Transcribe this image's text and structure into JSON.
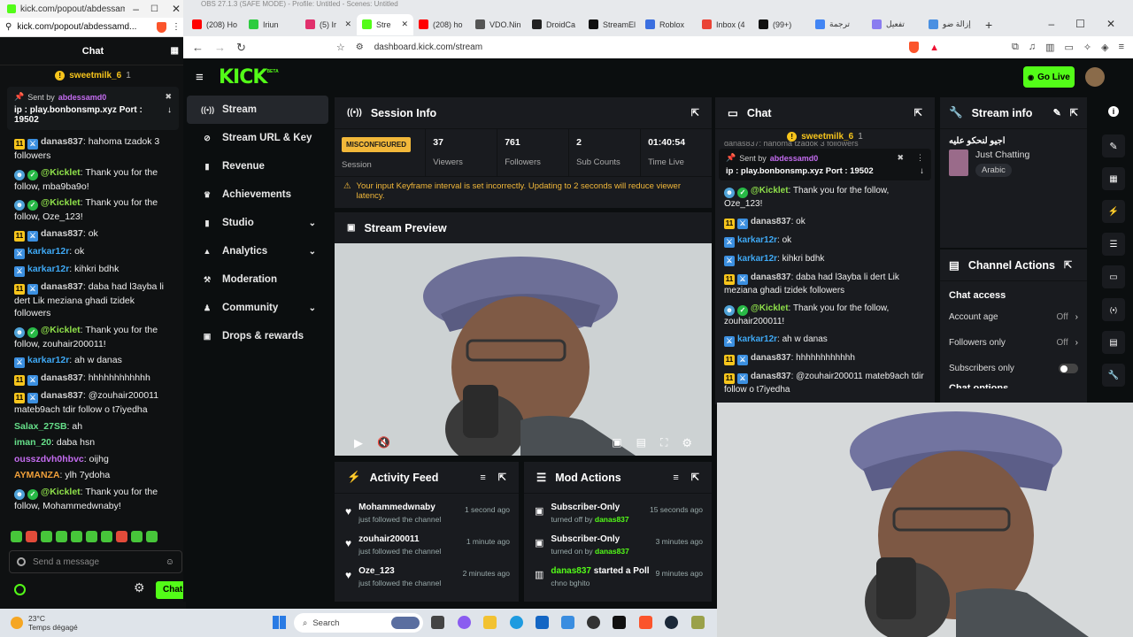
{
  "popout": {
    "window_title": "kick.com/popout/abdessam...",
    "url": "kick.com/popout/abdessamd...",
    "chat_title": "Chat",
    "gift_user": "sweetmilk_6",
    "gift_count": "1",
    "pinned_sent_by": "Sent by",
    "pinned_user": "abdessamd0",
    "pinned_text": "ip : play.bonbonsmp.xyz Port : 19502",
    "messages": [
      {
        "user": "danas837",
        "color": "#d2d2d2",
        "badges": [
          "y",
          "b"
        ],
        "text": "hahoma tzadok 3 followers"
      },
      {
        "user": "@Kicklet",
        "color": "#8fe04a",
        "badges": [
          "r",
          "g"
        ],
        "text": "Thank you for the follow, mba9ba9o!"
      },
      {
        "user": "@Kicklet",
        "color": "#8fe04a",
        "badges": [
          "r",
          "g"
        ],
        "text": "Thank you for the follow, Oze_123!"
      },
      {
        "user": "danas837",
        "color": "#d2d2d2",
        "badges": [
          "y",
          "b"
        ],
        "text": "ok"
      },
      {
        "user": "karkar12r",
        "color": "#3fa9f5",
        "badges": [
          "b"
        ],
        "text": "ok"
      },
      {
        "user": "karkar12r",
        "color": "#3fa9f5",
        "badges": [
          "b"
        ],
        "text": "kihkri bdhk"
      },
      {
        "user": "danas837",
        "color": "#d2d2d2",
        "badges": [
          "y",
          "b"
        ],
        "text": "daba had l3ayba li dert Lik meziana ghadi tzidek followers"
      },
      {
        "user": "@Kicklet",
        "color": "#8fe04a",
        "badges": [
          "r",
          "g"
        ],
        "text": "Thank you for the follow, zouhair200011!"
      },
      {
        "user": "karkar12r",
        "color": "#3fa9f5",
        "badges": [
          "b"
        ],
        "text": "ah w danas"
      },
      {
        "user": "danas837",
        "color": "#d2d2d2",
        "badges": [
          "y",
          "b"
        ],
        "text": "hhhhhhhhhhhh"
      },
      {
        "user": "danas837",
        "color": "#d2d2d2",
        "badges": [
          "y",
          "b"
        ],
        "text": "@zouhair200011 mateb9ach tdir follow o t7iyedha"
      },
      {
        "user": "Salax_27SB",
        "color": "#66e08a",
        "badges": [],
        "text": "ah"
      },
      {
        "user": "iman_20",
        "color": "#66e08a",
        "badges": [],
        "text": "daba hsn"
      },
      {
        "user": "ousszdvh0hbvc",
        "color": "#c46cf0",
        "badges": [],
        "text": "oijhg"
      },
      {
        "user": "AYMANZA",
        "color": "#f0a03a",
        "badges": [],
        "text": "ylh 7ydoha"
      },
      {
        "user": "@Kicklet",
        "color": "#8fe04a",
        "badges": [
          "r",
          "g"
        ],
        "text": "Thank you for the follow, Mohammedwnaby!"
      }
    ],
    "send_placeholder": "Send a message",
    "chat_button": "Chat"
  },
  "browser": {
    "os_title": "OBS 27.1.3 (SAFE MODE) - Profile: Untitled - Scenes: Untitled",
    "tabs": [
      {
        "label": "(208) Ho",
        "color": "#ff0000"
      },
      {
        "label": "Iriun",
        "color": "#2ecc40"
      },
      {
        "label": "(5) Ir",
        "color": "#e1306c"
      },
      {
        "label": "Stre",
        "color": "#53fc18"
      },
      {
        "label": "(208) ho",
        "color": "#ff0000"
      },
      {
        "label": "VDO.Nin",
        "color": "#555555"
      },
      {
        "label": "DroidCa",
        "color": "#222222"
      },
      {
        "label": "StreamEl",
        "color": "#111111"
      },
      {
        "label": "Roblox",
        "color": "#3b6fe0"
      },
      {
        "label": "Inbox (4",
        "color": "#ea4335"
      },
      {
        "label": "(99+)",
        "color": "#111111"
      },
      {
        "label": "ترجمة",
        "color": "#4285f4"
      },
      {
        "label": "تفعيل",
        "color": "#8a7cf0"
      },
      {
        "label": "إزالة ضو",
        "color": "#4a90e2"
      }
    ],
    "url": "dashboard.kick.com/stream"
  },
  "kick": {
    "logo": "KICK",
    "logo_beta": "BETA",
    "go_live": "Go Live",
    "nav": [
      {
        "label": "Stream",
        "icon": "broadcast-icon",
        "active": true
      },
      {
        "label": "Stream URL & Key",
        "icon": "link-icon"
      },
      {
        "label": "Revenue",
        "icon": "revenue-icon"
      },
      {
        "label": "Achievements",
        "icon": "trophy-icon"
      },
      {
        "label": "Studio",
        "icon": "studio-icon",
        "chevron": true
      },
      {
        "label": "Analytics",
        "icon": "analytics-icon",
        "chevron": true
      },
      {
        "label": "Moderation",
        "icon": "hammer-icon"
      },
      {
        "label": "Community",
        "icon": "community-icon",
        "chevron": true
      },
      {
        "label": "Drops & rewards",
        "icon": "gift-icon"
      }
    ],
    "session": {
      "title": "Session Info",
      "status_badge": "MISCONFIGURED",
      "status_label": "Session",
      "stats": [
        {
          "value": "37",
          "label": "Viewers"
        },
        {
          "value": "761",
          "label": "Followers"
        },
        {
          "value": "2",
          "label": "Sub Counts"
        },
        {
          "value": "01:40:54",
          "label": "Time Live"
        }
      ],
      "warning": "Your input Keyframe interval is set incorrectly. Updating to 2 seconds will reduce viewer latency."
    },
    "preview": {
      "title": "Stream Preview"
    },
    "activity": {
      "title": "Activity Feed",
      "items": [
        {
          "user": "Mohammedwnaby",
          "action": "just followed the channel",
          "ago": "1 second ago"
        },
        {
          "user": "zouhair200011",
          "action": "just followed the channel",
          "ago": "1 minute ago"
        },
        {
          "user": "Oze_123",
          "action": "just followed the channel",
          "ago": "2 minutes ago"
        }
      ]
    },
    "mod": {
      "title": "Mod Actions",
      "items": [
        {
          "title": "Subscriber-Only",
          "detail_prefix": "turned off by",
          "by": "danas837",
          "ago": "15 seconds ago"
        },
        {
          "title": "Subscriber-Only",
          "detail_prefix": "turned on by",
          "by": "danas837",
          "ago": "3 minutes ago"
        },
        {
          "title_user": "danas837",
          "title": "started a Poll",
          "detail_prefix": "chno bghito",
          "by": "",
          "ago": "9 minutes ago"
        }
      ]
    },
    "chat": {
      "title": "Chat",
      "gift_user": "sweetmilk_6",
      "gift_count": "1",
      "top_cut": "danas837: hahoma tzadok 3 followers",
      "pinned_sent_by": "Sent by",
      "pinned_user": "abdessamd0",
      "pinned_text": "ip : play.bonbonsmp.xyz Port : 19502",
      "messages": [
        {
          "user": "@Kicklet",
          "color": "#8fe04a",
          "badges": [
            "r",
            "g"
          ],
          "text": "Thank you for the follow, Oze_123!"
        },
        {
          "user": "danas837",
          "color": "#d2d2d2",
          "badges": [
            "y",
            "b"
          ],
          "text": "ok"
        },
        {
          "user": "karkar12r",
          "color": "#3fa9f5",
          "badges": [
            "b"
          ],
          "text": "ok"
        },
        {
          "user": "karkar12r",
          "color": "#3fa9f5",
          "badges": [
            "b"
          ],
          "text": "kihkri bdhk"
        },
        {
          "user": "danas837",
          "color": "#d2d2d2",
          "badges": [
            "y",
            "b"
          ],
          "text": "daba had l3ayba li dert Lik meziana ghadi tzidek followers"
        },
        {
          "user": "@Kicklet",
          "color": "#8fe04a",
          "badges": [
            "r",
            "g"
          ],
          "text": "Thank you for the follow, zouhair200011!"
        },
        {
          "user": "karkar12r",
          "color": "#3fa9f5",
          "badges": [
            "b"
          ],
          "text": "ah w danas"
        },
        {
          "user": "danas837",
          "color": "#d2d2d2",
          "badges": [
            "y",
            "b"
          ],
          "text": "hhhhhhhhhhhh"
        },
        {
          "user": "danas837",
          "color": "#d2d2d2",
          "badges": [
            "y",
            "b"
          ],
          "text": "@zouhair200011 mateb9ach tdir follow o t7iyedha"
        }
      ]
    },
    "stream_info": {
      "title": "Stream info",
      "stream_title": "اجيو لنحكو عليه",
      "category": "Just Chatting",
      "language": "Arabic"
    },
    "channel_actions": {
      "title": "Channel Actions",
      "section": "Chat access",
      "rows": [
        {
          "label": "Account age",
          "value": "Off"
        },
        {
          "label": "Followers only",
          "value": "Off"
        }
      ],
      "subs_only": "Subscribers only",
      "cut": "Chat options"
    }
  },
  "taskbar": {
    "temp": "23°C",
    "weather": "Temps dégagé",
    "search": "Search"
  },
  "colors": {
    "accent": "#53fc18",
    "warning": "#f2b83a"
  }
}
